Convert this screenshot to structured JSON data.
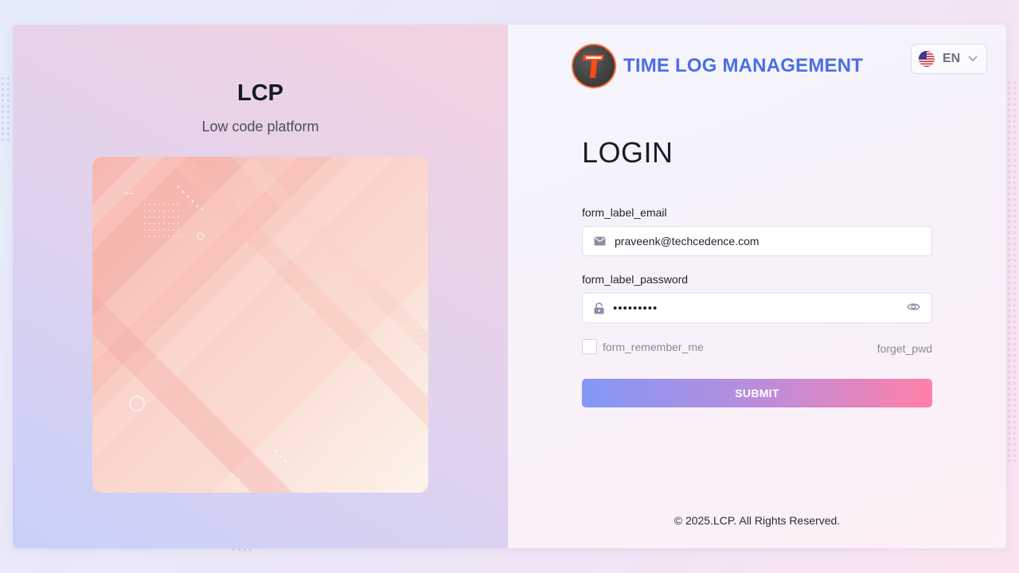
{
  "brand": {
    "title": "LCP",
    "subtitle": "Low code platform"
  },
  "header": {
    "logo_letter": "T",
    "app_title": "TIME LOG MANAGEMENT",
    "language": {
      "code": "EN",
      "flag_icon": "us-flag-icon"
    }
  },
  "login": {
    "heading": "LOGIN",
    "email_label": "form_label_email",
    "email_value": "praveenk@techcedence.com",
    "password_label": "form_label_password",
    "password_value": "•••••••••",
    "remember_label": "form_remember_me",
    "forgot_label": "forget_pwd",
    "submit_label": "SUBMIT"
  },
  "footer": {
    "copyright": "© 2025.LCP. All Rights Reserved."
  },
  "colors": {
    "accent": "#4a6fe3",
    "logo_ring": "#ff6a2f",
    "submit_start": "#8298f6",
    "submit_end": "#ff80a8"
  }
}
